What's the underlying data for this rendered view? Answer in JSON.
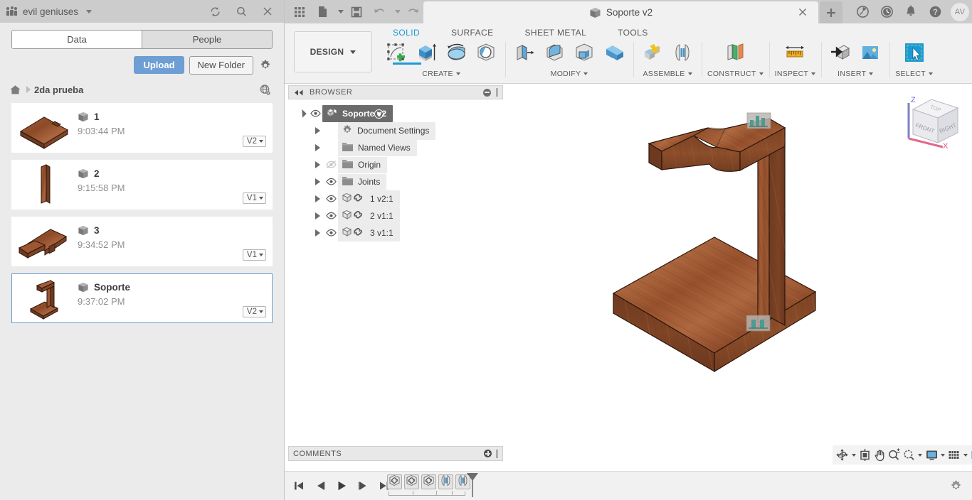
{
  "data_panel": {
    "hub_name": "evil geniuses",
    "hub_icon": "hub-people-icon",
    "header_icons": [
      "refresh-icon",
      "search-icon",
      "close-icon"
    ],
    "tabs": [
      {
        "label": "Data",
        "active": true
      },
      {
        "label": "People",
        "active": false
      }
    ],
    "upload_label": "Upload",
    "new_folder_label": "New Folder",
    "settings_icon": "gear-icon",
    "breadcrumb": {
      "home_icon": "home-icon",
      "folder": "2da prueba",
      "share_icon": "globe-share-icon"
    },
    "files": [
      {
        "name": "1",
        "time": "9:03:44 PM",
        "version": "V2",
        "selected": false,
        "thumb": "plate-with-notch"
      },
      {
        "name": "2",
        "time": "9:15:58 PM",
        "version": "V1",
        "selected": false,
        "thumb": "vertical-bar"
      },
      {
        "name": "3",
        "time": "9:34:52 PM",
        "version": "V1",
        "selected": false,
        "thumb": "curved-arm"
      },
      {
        "name": "Soporte",
        "time": "9:37:02 PM",
        "version": "V2",
        "selected": true,
        "thumb": "headphone-stand"
      }
    ]
  },
  "titlebar": {
    "quick_access": [
      "grid-apps-icon",
      "new-file-icon",
      "save-icon",
      "undo-icon",
      "redo-icon"
    ],
    "document_tab": {
      "title": "Soporte v2",
      "icon": "cube-icon",
      "close_icon": "close-icon"
    },
    "new_tab_icon": "plus-icon",
    "right_icons": [
      "job-status-icon",
      "recent-clock-icon",
      "notifications-bell-icon",
      "help-question-icon"
    ],
    "avatar_initials": "AV"
  },
  "ribbon": {
    "design_label": "DESIGN",
    "workspace_tabs": [
      {
        "label": "SOLID",
        "active": true
      },
      {
        "label": "SURFACE",
        "active": false
      },
      {
        "label": "SHEET METAL",
        "active": false
      },
      {
        "label": "TOOLS",
        "active": false
      }
    ],
    "groups": [
      {
        "label": "CREATE",
        "buttons": [
          {
            "name": "create-sketch",
            "icon": "sketch-plus-icon"
          },
          {
            "name": "extrude",
            "icon": "extrude-icon"
          },
          {
            "name": "revolve",
            "icon": "revolve-icon"
          },
          {
            "name": "sphere",
            "icon": "sphere-icon"
          }
        ]
      },
      {
        "label": "MODIFY",
        "buttons": [
          {
            "name": "press-pull",
            "icon": "press-pull-icon"
          },
          {
            "name": "fillet",
            "icon": "fillet-icon"
          },
          {
            "name": "shell",
            "icon": "shell-icon"
          },
          {
            "name": "combine",
            "icon": "combine-icon"
          }
        ]
      },
      {
        "label": "ASSEMBLE",
        "buttons": [
          {
            "name": "new-component",
            "icon": "new-component-icon"
          },
          {
            "name": "joint",
            "icon": "joint-icon"
          }
        ]
      },
      {
        "label": "CONSTRUCT",
        "buttons": [
          {
            "name": "offset-plane",
            "icon": "offset-plane-icon"
          }
        ]
      },
      {
        "label": "INSPECT",
        "buttons": [
          {
            "name": "measure",
            "icon": "measure-ruler-icon"
          }
        ]
      },
      {
        "label": "INSERT",
        "buttons": [
          {
            "name": "insert-derive",
            "icon": "insert-derive-icon"
          },
          {
            "name": "canvas-image",
            "icon": "image-canvas-icon"
          }
        ]
      },
      {
        "label": "SELECT",
        "buttons": [
          {
            "name": "select-tool",
            "icon": "select-arrow-icon"
          }
        ]
      }
    ]
  },
  "browser": {
    "title": "BROWSER",
    "collapse_icon": "collapse-left-icon",
    "nodes": [
      {
        "label": "Soporte v2",
        "icon": "component-icon",
        "eye": "visible",
        "selected": true,
        "indent": 0,
        "expander": "open",
        "radio": true
      },
      {
        "label": "Document Settings",
        "icon": "gear-icon",
        "eye": "none",
        "selected": false,
        "indent": 1,
        "expander": "closed",
        "radio": false
      },
      {
        "label": "Named Views",
        "icon": "folder-icon",
        "eye": "none",
        "selected": false,
        "indent": 1,
        "expander": "closed",
        "radio": false
      },
      {
        "label": "Origin",
        "icon": "folder-icon",
        "eye": "hidden",
        "selected": false,
        "indent": 1,
        "expander": "closed",
        "radio": false
      },
      {
        "label": "Joints",
        "icon": "folder-icon",
        "eye": "visible",
        "selected": false,
        "indent": 1,
        "expander": "closed",
        "radio": false
      },
      {
        "label": "1 v2:1",
        "icon": "body-link-icon",
        "eye": "visible",
        "selected": false,
        "indent": 1,
        "expander": "closed",
        "radio": false
      },
      {
        "label": "2 v1:1",
        "icon": "body-link-icon",
        "eye": "visible",
        "selected": false,
        "indent": 1,
        "expander": "closed",
        "radio": false
      },
      {
        "label": "3 v1:1",
        "icon": "body-link-icon",
        "eye": "visible",
        "selected": false,
        "indent": 1,
        "expander": "closed",
        "radio": false
      }
    ]
  },
  "comments": {
    "title": "COMMENTS",
    "add_icon": "add-comment-icon"
  },
  "canvas": {
    "model_name": "headphone-stand",
    "joint_markers": 2,
    "viewcube": {
      "top": "TOP",
      "front": "FRONT",
      "right": "RIGHT",
      "axes": [
        "Z",
        "X"
      ]
    },
    "nav_bar": [
      {
        "name": "orbit",
        "icon": "orbit-icon",
        "caret": true
      },
      {
        "name": "look-at",
        "icon": "look-at-icon",
        "caret": false
      },
      {
        "name": "pan",
        "icon": "pan-hand-icon",
        "caret": false
      },
      {
        "name": "zoom",
        "icon": "zoom-magnifier-icon",
        "caret": false
      },
      {
        "name": "fit",
        "icon": "fit-view-icon",
        "caret": true
      },
      {
        "name": "display-settings",
        "icon": "display-monitor-icon",
        "caret": true
      },
      {
        "name": "grid-snaps",
        "icon": "grid-icon",
        "caret": true
      },
      {
        "name": "viewports",
        "icon": "viewports-icon",
        "caret": true
      }
    ]
  },
  "timeline": {
    "playback": [
      "skip-start-icon",
      "step-back-icon",
      "play-icon",
      "step-forward-icon",
      "skip-end-icon"
    ],
    "items": [
      {
        "name": "insert-component-1",
        "icon": "component-link-icon"
      },
      {
        "name": "insert-component-2",
        "icon": "component-link-icon"
      },
      {
        "name": "insert-component-3",
        "icon": "component-link-icon"
      },
      {
        "name": "joint-1",
        "icon": "joint-icon"
      },
      {
        "name": "joint-2",
        "icon": "joint-icon"
      }
    ],
    "settings_icon": "gear-icon"
  },
  "colors": {
    "accent_blue": "#1c9ad6",
    "upload_blue": "#6d9ed4",
    "wood_light": "#b0693f",
    "wood_mid": "#9a5530",
    "wood_dark": "#7c3f22",
    "panel_gray": "#ebebeb",
    "titlebar_gray": "#cccccc"
  }
}
